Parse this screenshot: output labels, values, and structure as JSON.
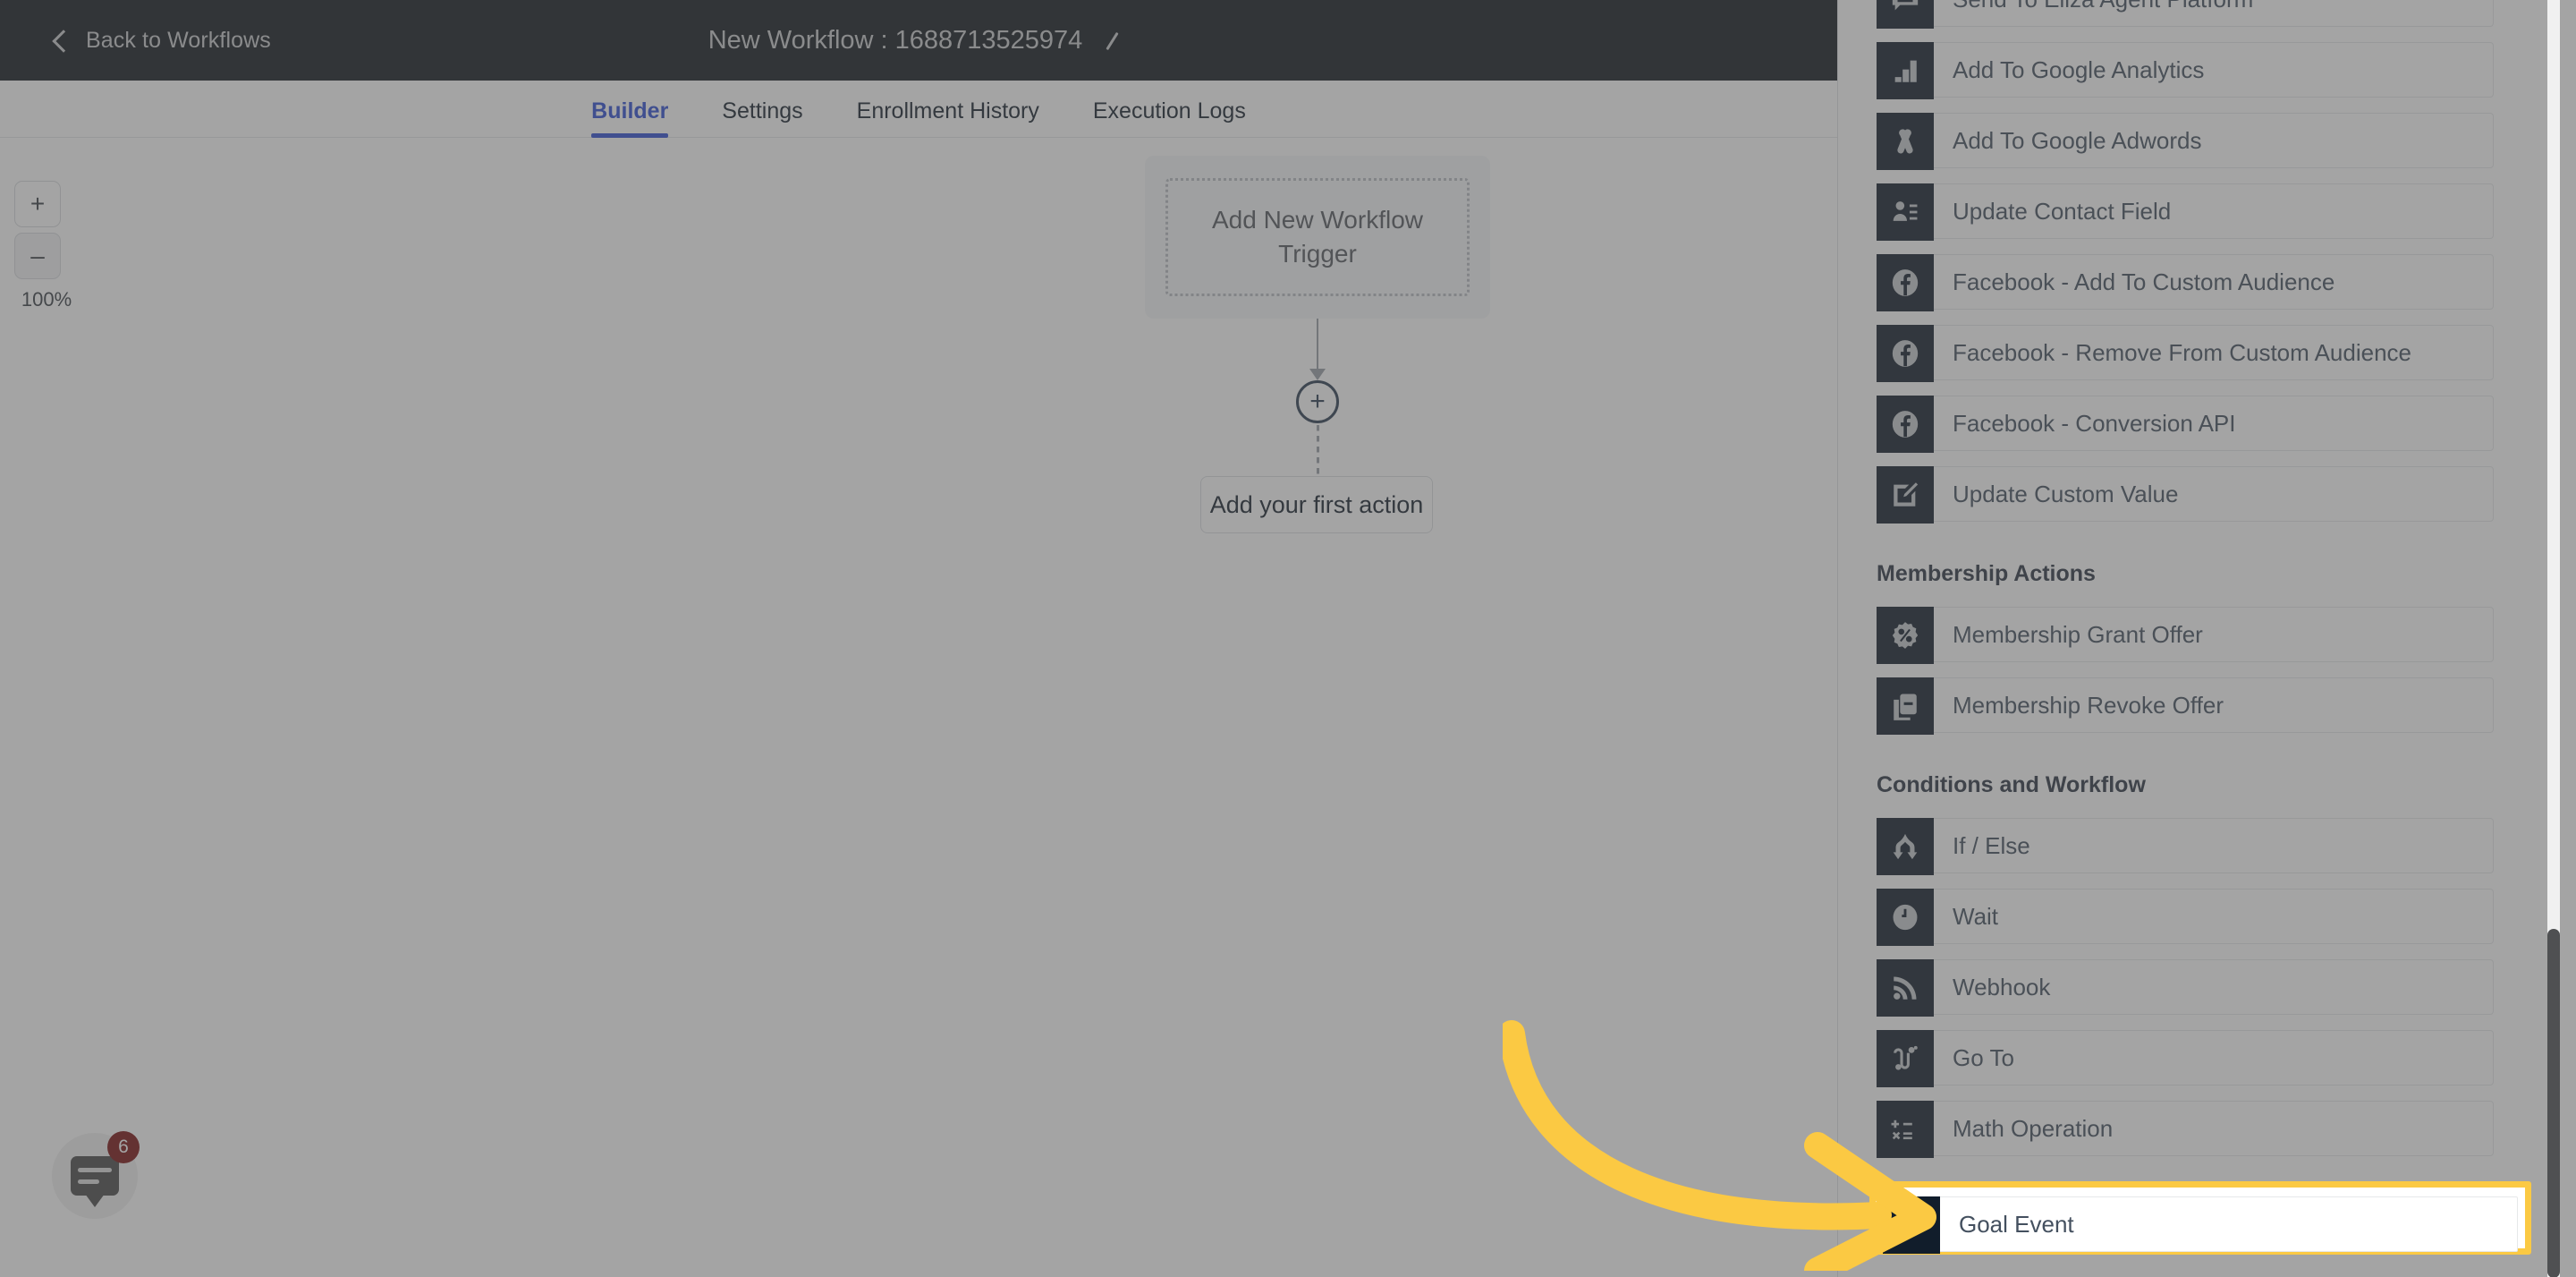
{
  "topbar": {
    "back_label": "Back to Workflows",
    "back_icon": "chevron-left-icon",
    "title": "New Workflow : 1688713525974",
    "edit_icon": "pencil-icon"
  },
  "tabs": [
    {
      "label": "Builder",
      "active": true
    },
    {
      "label": "Settings",
      "active": false
    },
    {
      "label": "Enrollment History",
      "active": false
    },
    {
      "label": "Execution Logs",
      "active": false
    }
  ],
  "canvas": {
    "zoom_in_label": "+",
    "zoom_out_label": "–",
    "zoom_level": "100%",
    "trigger_placeholder": "Add New Workflow Trigger",
    "add_node_label": "+",
    "first_action_label": "Add your first action"
  },
  "chat_widget": {
    "icon": "chat-bubble-icon",
    "badge_count": "6"
  },
  "panel": {
    "sections": [
      {
        "heading": null,
        "items": [
          {
            "label": "Send To Eliza Agent Platform",
            "icon": "chat-list-icon"
          },
          {
            "label": "Add To Google Analytics",
            "icon": "google-analytics-icon"
          },
          {
            "label": "Add To Google Adwords",
            "icon": "google-ads-icon"
          },
          {
            "label": "Update Contact Field",
            "icon": "contact-card-icon"
          },
          {
            "label": "Facebook - Add To Custom Audience",
            "icon": "facebook-icon"
          },
          {
            "label": "Facebook - Remove From Custom Audience",
            "icon": "facebook-icon"
          },
          {
            "label": "Facebook - Conversion API",
            "icon": "facebook-icon"
          },
          {
            "label": "Update Custom Value",
            "icon": "edit-square-icon"
          }
        ]
      },
      {
        "heading": "Membership Actions",
        "items": [
          {
            "label": "Membership Grant Offer",
            "icon": "percent-badge-icon"
          },
          {
            "label": "Membership Revoke Offer",
            "icon": "card-minus-icon"
          }
        ]
      },
      {
        "heading": "Conditions and Workflow",
        "items": [
          {
            "label": "If / Else",
            "icon": "branch-icon"
          },
          {
            "label": "Wait",
            "icon": "clock-icon"
          },
          {
            "label": "Webhook",
            "icon": "rss-icon"
          },
          {
            "label": "Go To",
            "icon": "goto-path-icon"
          },
          {
            "label": "Math Operation",
            "icon": "math-operators-icon"
          }
        ]
      }
    ],
    "highlighted_item": {
      "label": "Goal Event",
      "icon": "checkered-flag-icon"
    },
    "scrollbar": "vertical-scrollbar"
  },
  "annotation": {
    "arrow": "curved-arrow-pointing-right",
    "color": "#fbc943"
  },
  "colors": {
    "header_bg": "#12171f",
    "accent_blue": "#2e4fd4",
    "icon_tile": "#111d2b",
    "highlight_yellow": "#fbc943",
    "badge_red": "#7a1111"
  }
}
